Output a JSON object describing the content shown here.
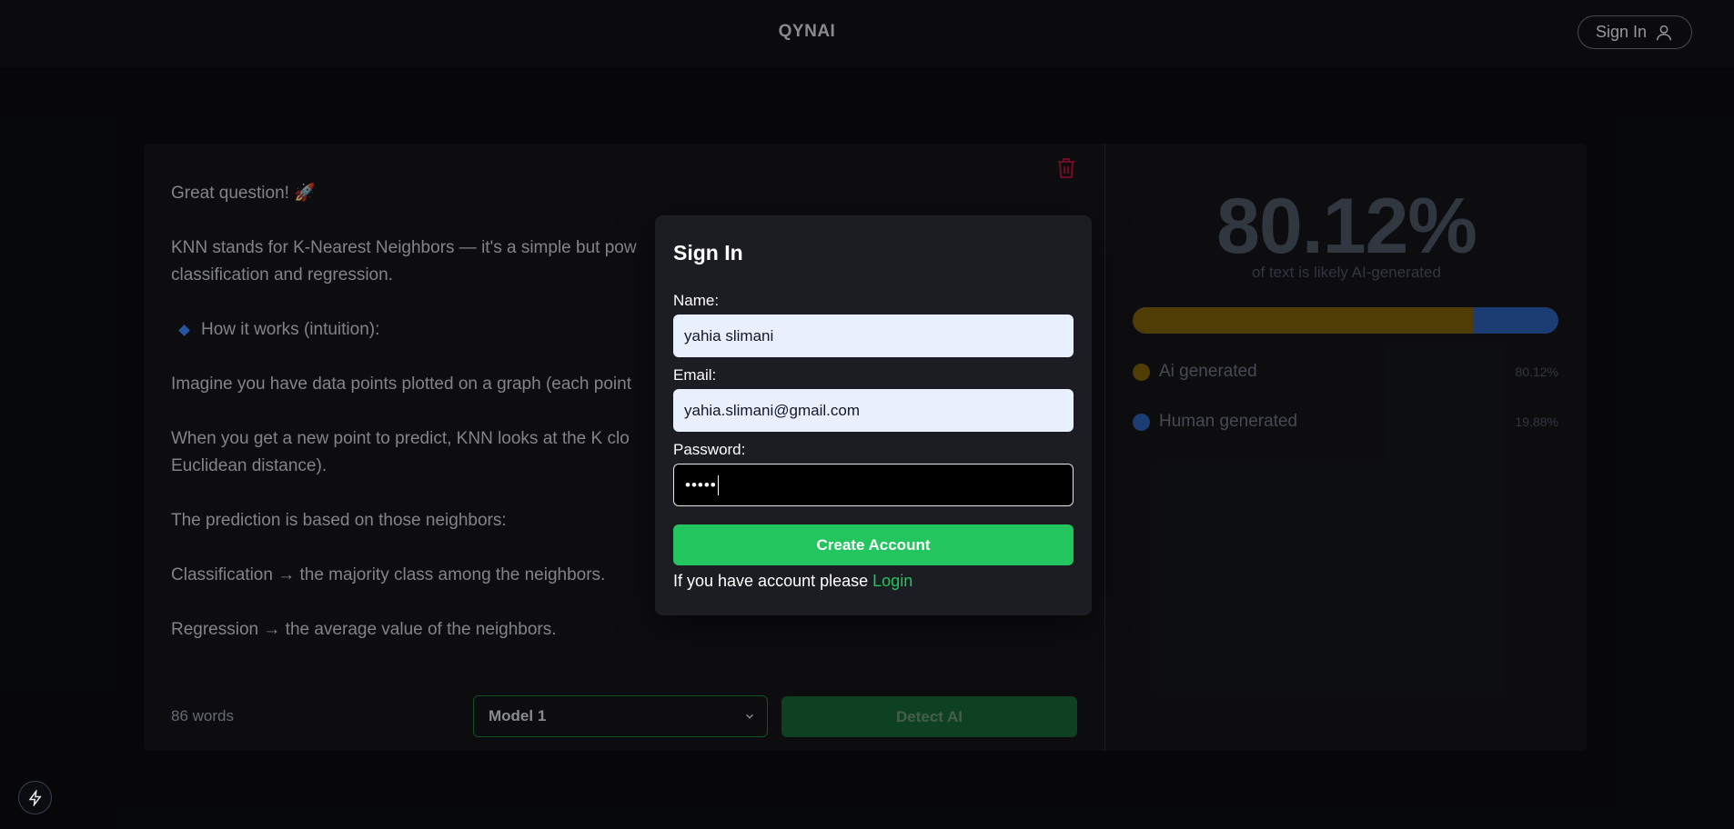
{
  "header": {
    "brand": "QYNAI",
    "signin_label": "Sign In"
  },
  "editor": {
    "paragraphs": [
      "Great question! 🚀",
      "KNN stands for K-Nearest Neighbors — it's a simple but pow",
      "classification and regression.",
      "How it works (intuition):",
      "Imagine you have data points plotted on a graph (each point",
      "When you get a new point to predict, KNN looks at the K clo",
      "Euclidean distance).",
      "The prediction is based on those neighbors:",
      "Classification → the majority class among the neighbors.",
      "Regression → the average value of the neighbors."
    ],
    "word_count": "86 words",
    "model_selected": "Model 1",
    "detect_label": "Detect AI"
  },
  "result": {
    "percent": "80.12%",
    "subtitle": "of text is likely AI-generated",
    "ai_fraction": 0.8012,
    "legend": [
      {
        "label": "Ai generated",
        "value": "80.12%",
        "color": "#7a5f08"
      },
      {
        "label": "Human generated",
        "value": "19.88%",
        "color": "#2b5db3"
      }
    ]
  },
  "modal": {
    "title": "Sign In",
    "name_label": "Name:",
    "name_value": "yahia slimani",
    "email_label": "Email:",
    "email_value": "yahia.slimani@gmail.com",
    "password_label": "Password:",
    "password_value": "•••••",
    "create_label": "Create Account",
    "login_prompt": "If you have account please ",
    "login_link": "Login"
  },
  "colors": {
    "accent_green": "#22c55e",
    "ai_color": "#7a5f08",
    "human_color": "#2b5db3"
  }
}
